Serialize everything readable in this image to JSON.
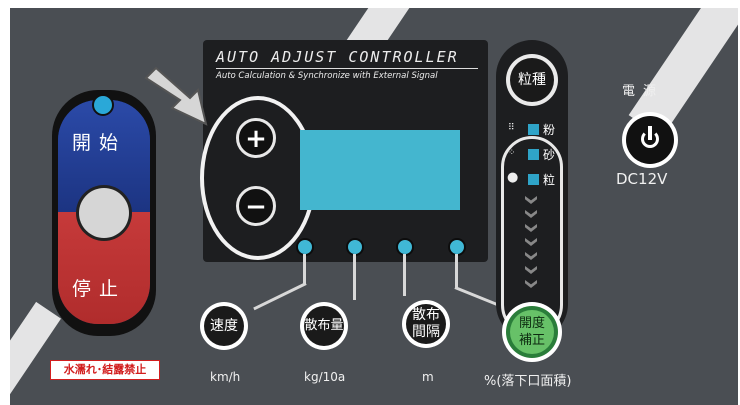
{
  "panel_title": "AUTO  ADJUST  CONTROLLER",
  "panel_subtitle": "Auto Calculation & Synchronize with External Signal",
  "start_label": "開始",
  "stop_label": "停止",
  "warning": "水濡れ･結露禁止",
  "buttons": {
    "plus": "+",
    "minus": "−",
    "speed": "速度",
    "spread_amount": [
      "散布量"
    ],
    "spread_interval": [
      "散布",
      "間隔"
    ],
    "aperture": [
      "開度",
      "補正"
    ],
    "grain_type": "粒種"
  },
  "units": {
    "speed": "km/h",
    "spread_amount": "kg/10a",
    "spread_interval": "m",
    "aperture": "%(落下口面積)"
  },
  "grain_options": [
    {
      "icon": "fine-powder-icon",
      "label": "粉"
    },
    {
      "icon": "sand-icon",
      "label": "砂"
    },
    {
      "icon": "granule-icon",
      "label": "粒"
    }
  ],
  "power": {
    "label": "電源",
    "voltage": "DC12V"
  },
  "colors": {
    "panel": "#4a4e53",
    "display": "#44b6cf",
    "led": "#40b8d6",
    "start": "#2b4aa8",
    "stop": "#c63a3a",
    "aperture": "#67c168",
    "warning": "#d21e1e"
  }
}
